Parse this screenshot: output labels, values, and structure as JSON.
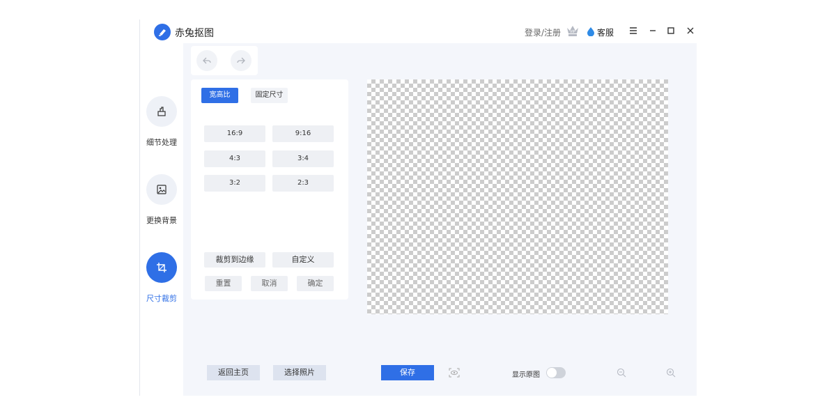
{
  "app": {
    "title": "赤兔抠图"
  },
  "header": {
    "login_label": "登录/注册",
    "vip_icon": "vip-crown-icon",
    "service_label": "客服",
    "controls": [
      "menu-icon",
      "minimize-icon",
      "maximize-icon",
      "close-icon"
    ]
  },
  "sidebar": {
    "items": [
      {
        "label": "细节处理",
        "icon": "brush-icon",
        "active": false
      },
      {
        "label": "更换背景",
        "icon": "image-icon",
        "active": false
      },
      {
        "label": "尺寸裁剪",
        "icon": "crop-icon",
        "active": true
      }
    ]
  },
  "history": {
    "undo_icon": "undo-icon",
    "redo_icon": "redo-icon"
  },
  "crop_panel": {
    "tabs": [
      "宽高比",
      "固定尺寸"
    ],
    "selected_tab": "宽高比",
    "ratios": [
      "16:9",
      "9:16",
      "4:3",
      "3:4",
      "3:2",
      "2:3"
    ],
    "crop_to_edge": "裁剪到边缘",
    "custom": "自定义",
    "reset": "重置",
    "cancel": "取消",
    "confirm": "确定"
  },
  "footer": {
    "home": "返回主页",
    "choose_photo": "选择照片",
    "save": "保存",
    "show_original": "显示原图",
    "show_original_on": false
  },
  "colors": {
    "accent": "#2f6fe6",
    "background": "#f4f6fb",
    "disabled": "#8fb3f0"
  }
}
